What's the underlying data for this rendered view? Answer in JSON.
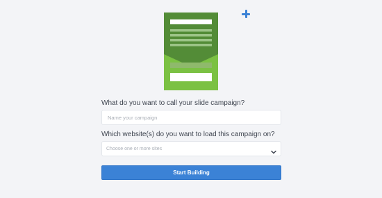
{
  "illustration": {
    "icon": "slide-campaign-illustration",
    "colors": {
      "dark_green": "#538c37",
      "light_green": "#7bc143",
      "mid_green": "#8fb96c"
    }
  },
  "add_icon": {
    "icon": "plus-icon",
    "color": "#3b82d6"
  },
  "form": {
    "campaign_name_label": "What do you want to call your slide campaign?",
    "campaign_name_value": "",
    "campaign_name_placeholder": "Name your campaign",
    "sites_label": "Which website(s) do you want to load this campaign on?",
    "sites_placeholder": "Choose one or more sites",
    "submit_label": "Start Building"
  },
  "colors": {
    "accent": "#3b82d6",
    "background": "#f3f4f7"
  }
}
